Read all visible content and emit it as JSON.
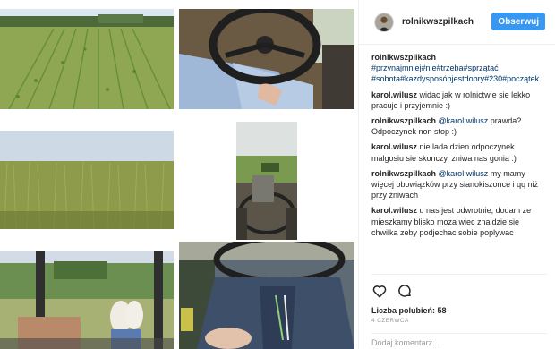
{
  "header": {
    "username": "rolnikwszpilkach",
    "follow_label": "Obserwuj"
  },
  "caption": {
    "user": "rolnikwszpilkach",
    "hashtags": "#przynajmniej#nie#trzeba#sprzątać #sobota#kazdysposóbjestdobry#230#początek"
  },
  "comments": [
    {
      "user": "karol.wilusz",
      "mention": "",
      "text": "widac jak w rolnictwie sie lekko pracuje i przyjemnie :)"
    },
    {
      "user": "rolnikwszpilkach",
      "mention": "@karol.wilusz",
      "text": "prawda? Odpoczynek non stop :)"
    },
    {
      "user": "karol.wilusz",
      "mention": "",
      "text": "nie lada dzien odpoczynek malgosiu sie skonczy, zniwa nas gonia :)"
    },
    {
      "user": "rolnikwszpilkach",
      "mention": "@karol.wilusz",
      "text": "my mamy więcej obowiązków przy sianokiszonce i qq niż przy żniwach"
    },
    {
      "user": "karol.wilusz",
      "mention": "",
      "text": "u nas jest odwrotnie, dodam ze mieszkamy blisko moza wiec znajdzie sie chwilka zeby podjechac sobie poplywac"
    }
  ],
  "likes_label": "Liczba polubień: 58",
  "date_label": "4 CZERWCA",
  "add_comment_placeholder": "Dodaj komentarz...",
  "icons": {
    "like": "heart-icon",
    "comment": "comment-icon"
  },
  "colors": {
    "follow_button": "#3897f0",
    "link": "#003569"
  }
}
